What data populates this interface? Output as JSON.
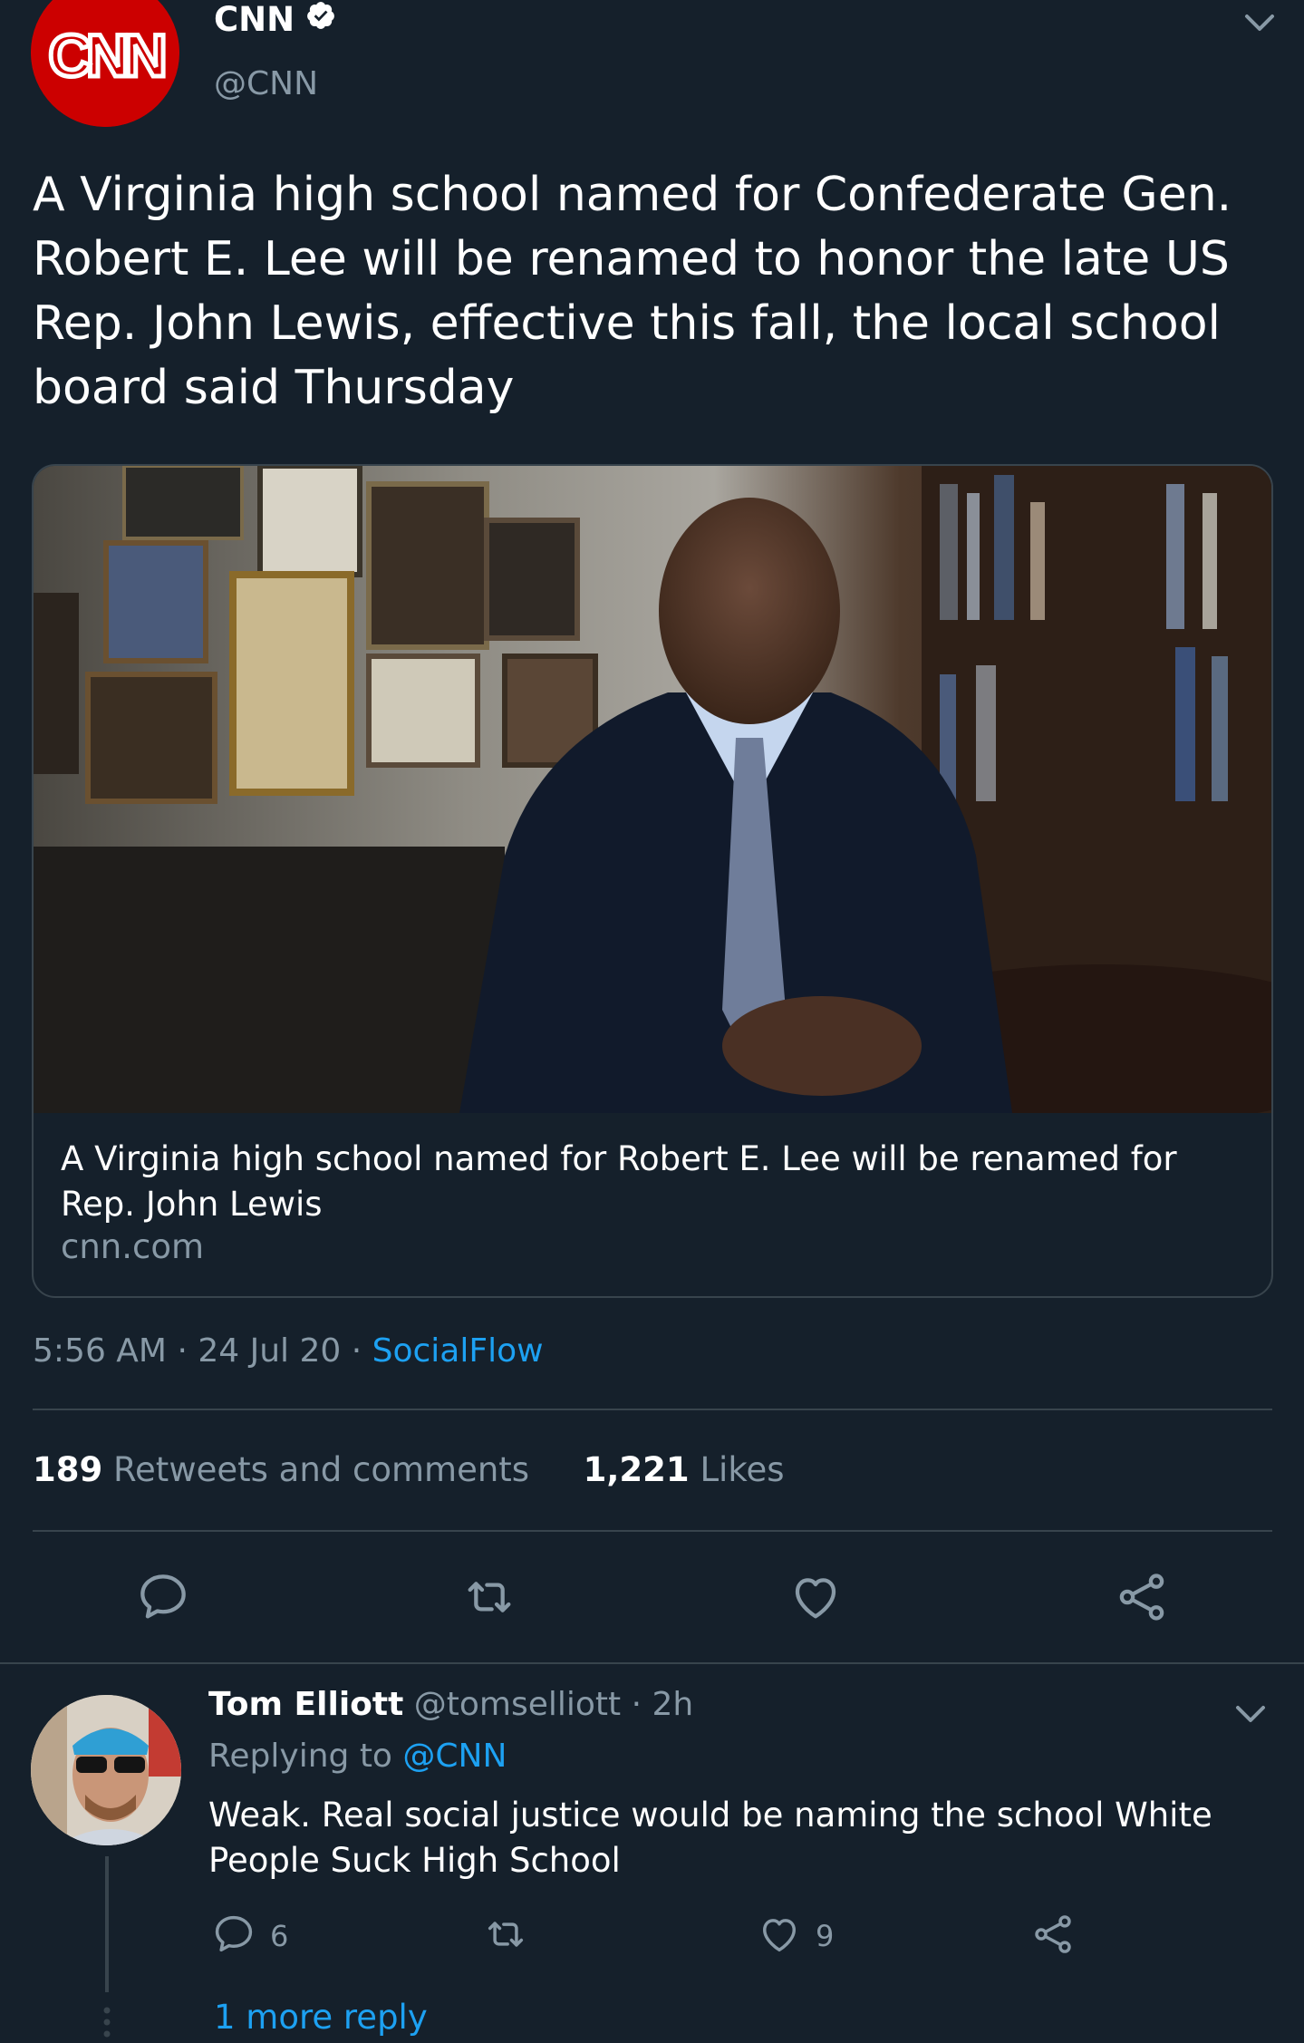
{
  "author": {
    "name": "CNN",
    "handle": "@CNN",
    "avatar_logo_text": "CNN",
    "verified": true
  },
  "tweet": {
    "text": "A Virginia high school named for Confederate Gen. Robert E. Lee will be renamed to honor the late US Rep. John Lewis, effective this fall, the local school board said Thursday",
    "card": {
      "title": "A Virginia high school named for Robert E. Lee will be renamed for Rep. John Lewis",
      "domain": "cnn.com"
    },
    "time": "5:56 AM",
    "date": "24 Jul 20",
    "source": "SocialFlow",
    "retweets_count": "189",
    "retweets_label": "Retweets and comments",
    "likes_count": "1,221",
    "likes_label": "Likes"
  },
  "reply": {
    "name": "Tom Elliott",
    "handle": "@tomselliott",
    "age": "2h",
    "replying_label": "Replying to",
    "replying_to": "@CNN",
    "text": "Weak. Real social justice would be naming the school White People Suck High School",
    "reply_count": "6",
    "like_count": "9",
    "more_replies": "1 more reply"
  },
  "colors": {
    "background": "#15202b",
    "muted": "#8899a6",
    "link": "#1da1f2",
    "divider": "#38444d",
    "cnn_red": "#cc0000"
  },
  "icons": [
    "chevron-down-icon",
    "verified-badge-icon",
    "comment-icon",
    "retweet-icon",
    "heart-icon",
    "share-icon"
  ]
}
